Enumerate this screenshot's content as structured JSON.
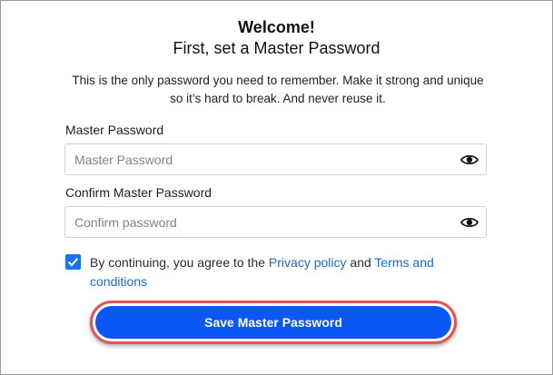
{
  "header": {
    "welcome": "Welcome!",
    "subtitle": "First, set a Master Password",
    "description": "This is the only password you need to remember. Make it strong and unique so it’s hard to break. And never reuse it."
  },
  "master_password": {
    "label": "Master Password",
    "placeholder": "Master Password",
    "value": "",
    "toggle_icon": "eye-icon"
  },
  "confirm_password": {
    "label": "Confirm Master Password",
    "placeholder": "Confirm password",
    "value": "",
    "toggle_icon": "eye-icon"
  },
  "agreement": {
    "checked": true,
    "prefix": "By continuing, you agree to the ",
    "privacy_link": "Privacy policy",
    "connector": " and ",
    "terms_link": "Terms and conditions"
  },
  "save_button": {
    "label": "Save Master Password"
  },
  "colors": {
    "accent": "#0b57f5",
    "link": "#1a66d6",
    "highlight_ring": "#e2545a",
    "checkbox": "#1a73e8"
  }
}
